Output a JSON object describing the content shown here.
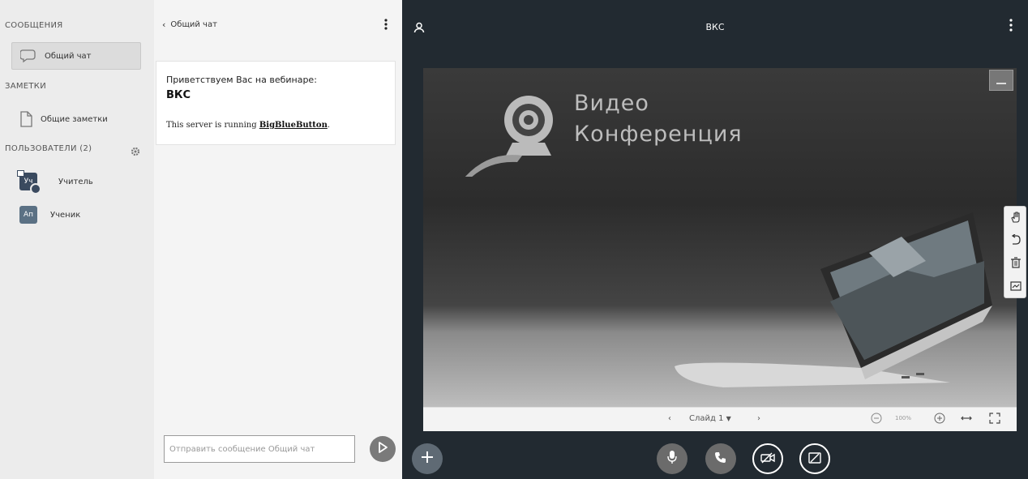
{
  "sidebar": {
    "messages_title": "СООБЩЕНИЯ",
    "chat_item": "Общий чат",
    "notes_title": "ЗАМЕТКИ",
    "notes_item": "Общие заметки",
    "users_title": "ПОЛЬЗОВАТЕЛИ (2)",
    "users": [
      {
        "initials": "Уч",
        "name": "Учитель"
      },
      {
        "initials": "Ап",
        "name": "Ученик"
      }
    ]
  },
  "chat": {
    "back_label": "Общий чат",
    "welcome_line1": "Приветствуем Вас на вебинаре:",
    "welcome_line2": "ВКС",
    "server_prefix": "This server is running ",
    "server_link": "BigBlueButton",
    "server_suffix": ".",
    "input_placeholder": "Отправить сообщение Общий чат"
  },
  "main": {
    "room_title": "ВКС",
    "slide_title_line1": "Видео",
    "slide_title_line2": "Конференция",
    "slide_label": "Слайд 1",
    "zoom_level": "100%"
  },
  "colors": {
    "main_bg": "#222a31",
    "sidebar_bg": "#ececec",
    "chat_bg": "#f4f4f4"
  },
  "icons": [
    "chat-bubble-icon",
    "notes-icon",
    "gear-icon",
    "chevron-left-icon",
    "kebab-menu-icon",
    "send-icon",
    "user-list-icon",
    "minimize-icon",
    "hand-tool-icon",
    "undo-icon",
    "trash-icon",
    "whiteboard-icon",
    "zoom-out-icon",
    "zoom-in-icon",
    "fit-width-icon",
    "fullscreen-icon",
    "plus-icon",
    "microphone-icon",
    "phone-icon",
    "camera-off-icon",
    "screen-share-off-icon"
  ]
}
